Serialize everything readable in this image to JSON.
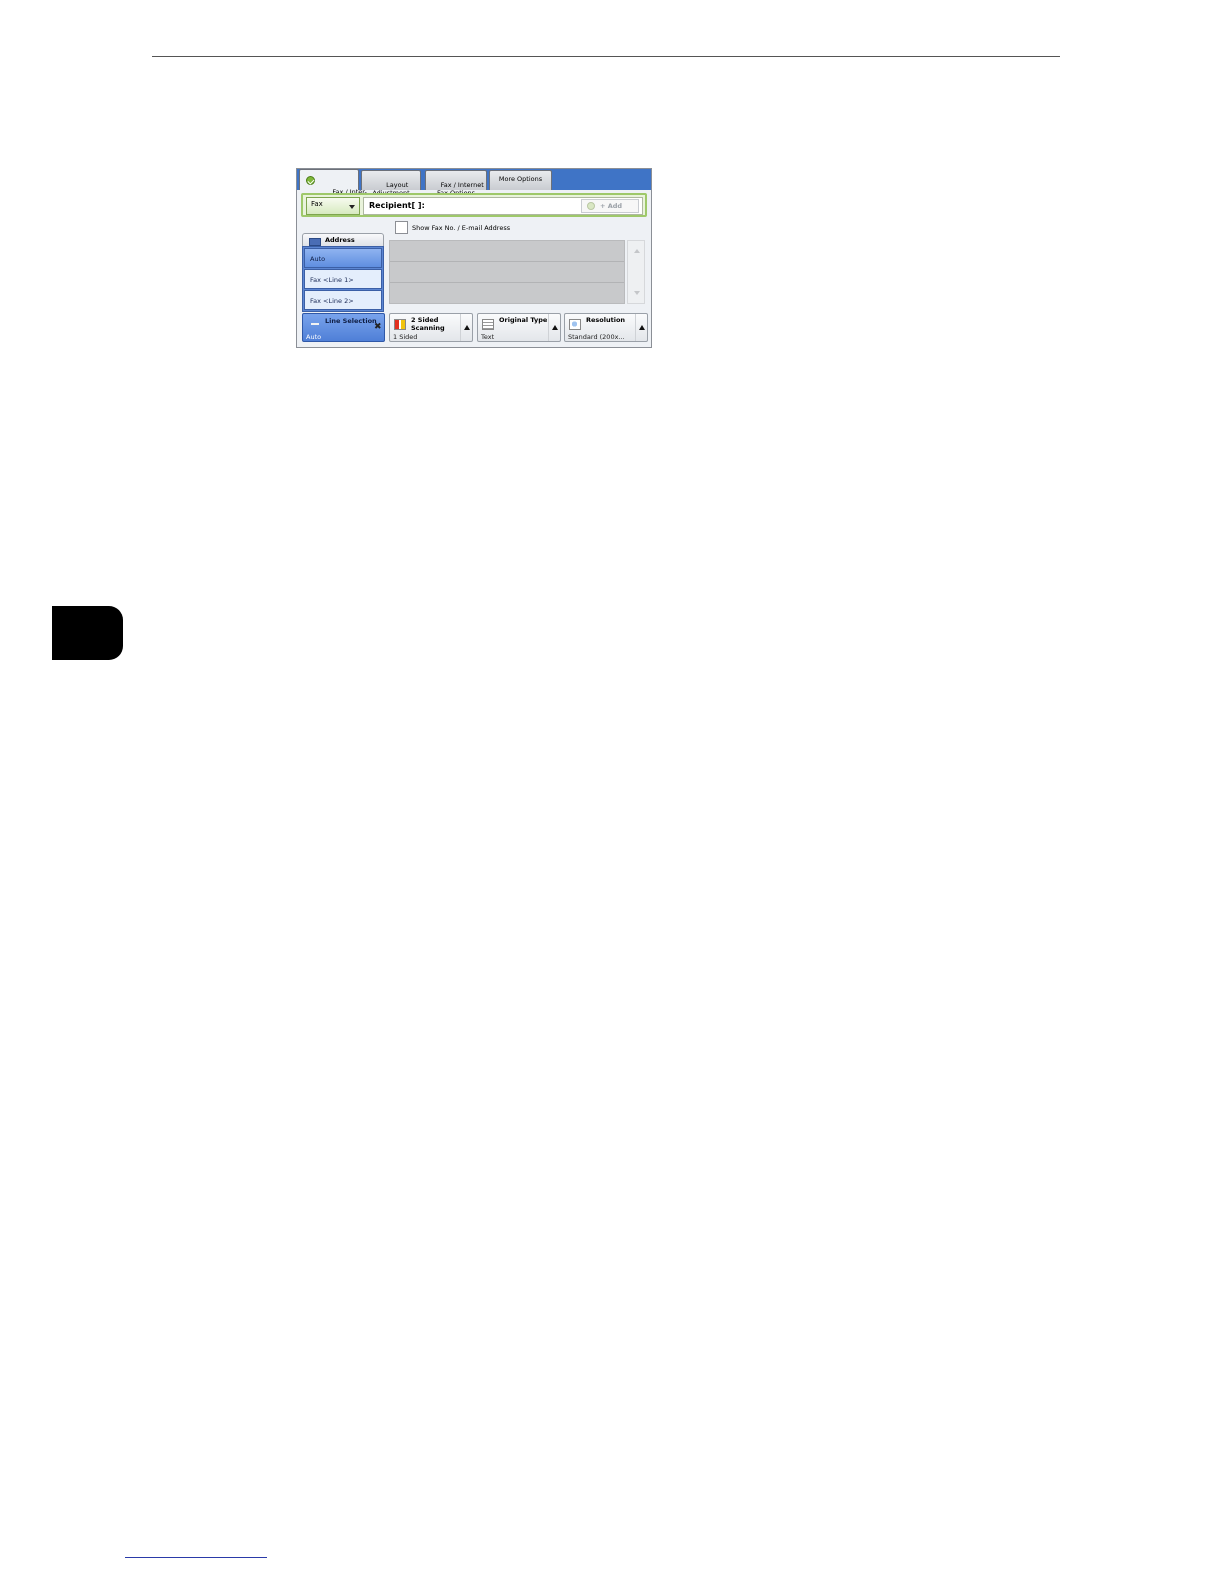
{
  "panel": {
    "tabs": [
      "Fax / Inter-\nnet Fax",
      "Layout\nAdjustment",
      "Fax / Internet\nFax Options",
      "More Options"
    ],
    "fax_type": "Fax",
    "recipient_label": "Recipient[   ]:",
    "add_button": "+ Add",
    "show_fax_checkbox_label": "Show Fax No. / E-mail Address",
    "address_button": "Address",
    "line_options": [
      "Auto",
      "Fax <Line 1>",
      "Fax <Line 2>"
    ],
    "line_selection": {
      "title": "Line Selection",
      "value": "Auto"
    },
    "features": [
      {
        "title": "2 Sided\nScanning",
        "value": "1 Sided",
        "icon": "two-sided-icon"
      },
      {
        "title": "Original Type",
        "value": "Text",
        "icon": "document-icon"
      },
      {
        "title": "Resolution",
        "value": "Standard (200x...",
        "icon": "resolution-icon"
      }
    ]
  }
}
